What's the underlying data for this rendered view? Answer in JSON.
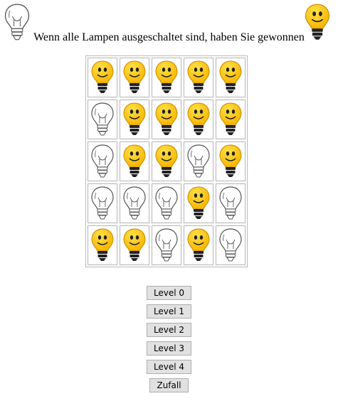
{
  "header": {
    "title": "Wenn alle Lampen ausgeschaltet sind, haben Sie gewonnen",
    "left_icon": "bulb-off-icon",
    "right_icon": "bulb-on-icon"
  },
  "board": {
    "rows": 5,
    "cols": 5,
    "states": [
      [
        1,
        1,
        1,
        1,
        1
      ],
      [
        0,
        1,
        1,
        1,
        1
      ],
      [
        0,
        1,
        1,
        0,
        1
      ],
      [
        0,
        0,
        0,
        1,
        0
      ],
      [
        1,
        1,
        0,
        1,
        0
      ]
    ],
    "legend": {
      "1": "on",
      "0": "off"
    }
  },
  "buttons": [
    {
      "label": "Level 0"
    },
    {
      "label": "Level 1"
    },
    {
      "label": "Level 2"
    },
    {
      "label": "Level 3"
    },
    {
      "label": "Level 4"
    },
    {
      "label": "Zufall"
    }
  ],
  "colors": {
    "bulb_on": "#f7b500",
    "bulb_on_highlight": "#ffe14a",
    "bulb_base": "#222222",
    "bulb_off_stroke": "#555555",
    "button_bg": "#e1e1e1"
  }
}
